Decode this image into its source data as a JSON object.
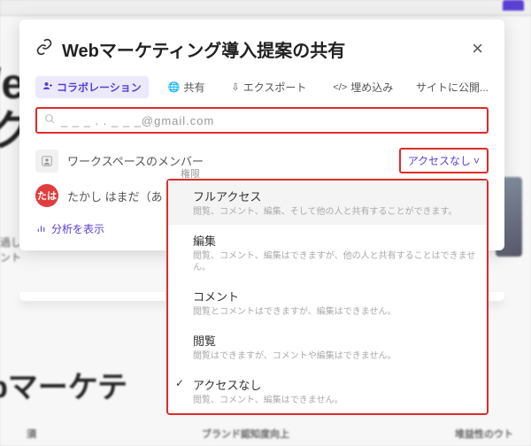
{
  "background": {
    "title_line1": "/e",
    "title_line2": "ク",
    "subtext": "過し",
    "subtext2": "ント",
    "heading2": "bマーケテ",
    "foot1": "須",
    "foot2": "ブランド認知度向上",
    "foot3": "堆益性のウト"
  },
  "modal": {
    "title": "Webマーケティング導入提案の共有"
  },
  "tabs": {
    "collab": "コラボレーション",
    "share": "共有",
    "export": "エクスポート",
    "embed": "埋め込み",
    "publish": "サイトに公開..."
  },
  "search": {
    "value": "_ _ _ . . _ _ _@gmail.com"
  },
  "workspace": {
    "label": "ワークスペースのメンバー",
    "access": "アクセスなし"
  },
  "user": {
    "avatar": "たは",
    "name": "たかし はまだ（あ"
  },
  "analytics": {
    "label": "分析を表示"
  },
  "permissions": {
    "header": "権限",
    "items": [
      {
        "title": "フルアクセス",
        "desc": "閲覧、コメント、編集、そして他の人と共有することができます。"
      },
      {
        "title": "編集",
        "desc": "閲覧、コメント、編集はできますが、他の人と共有することはできません。"
      },
      {
        "title": "コメント",
        "desc": "閲覧とコメントはできますが、編集はできません。"
      },
      {
        "title": "閲覧",
        "desc": "閲覧はできますが、コメントや編集はできません。"
      },
      {
        "title": "アクセスなし",
        "desc": "閲覧、コメント、編集はできません。"
      }
    ]
  }
}
